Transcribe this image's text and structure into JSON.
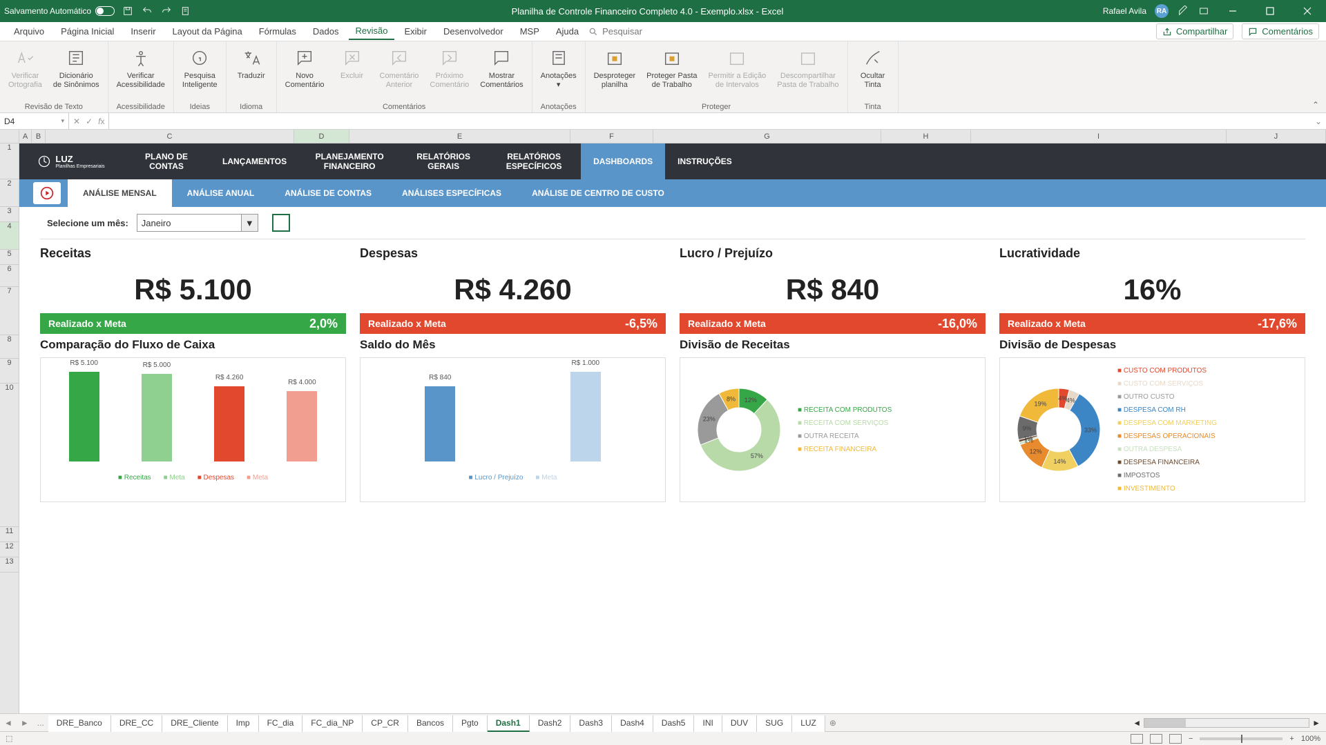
{
  "titlebar": {
    "autosave": "Salvamento Automático",
    "title": "Planilha de Controle Financeiro Completo 4.0 - Exemplo.xlsx  -  Excel",
    "user": "Rafael Avila",
    "initials": "RA"
  },
  "menu": {
    "items": [
      "Arquivo",
      "Página Inicial",
      "Inserir",
      "Layout da Página",
      "Fórmulas",
      "Dados",
      "Revisão",
      "Exibir",
      "Desenvolvedor",
      "MSP",
      "Ajuda"
    ],
    "active": "Revisão",
    "search": "Pesquisar",
    "share": "Compartilhar",
    "comments": "Comentários"
  },
  "ribbon": {
    "g1": {
      "label": "Revisão de Texto",
      "b1a": "Verificar",
      "b1b": "Ortografia",
      "b2a": "Dicionário",
      "b2b": "de Sinônimos"
    },
    "g2": {
      "label": "Acessibilidade",
      "b1a": "Verificar",
      "b1b": "Acessibilidade"
    },
    "g3": {
      "label": "Ideias",
      "b1a": "Pesquisa",
      "b1b": "Inteligente"
    },
    "g4": {
      "label": "Idioma",
      "b1": "Traduzir"
    },
    "g5": {
      "label": "Comentários",
      "b1a": "Novo",
      "b1b": "Comentário",
      "b2": "Excluir",
      "b3a": "Comentário",
      "b3b": "Anterior",
      "b4a": "Próximo",
      "b4b": "Comentário",
      "b5a": "Mostrar",
      "b5b": "Comentários"
    },
    "g6": {
      "label": "Anotações",
      "b1": "Anotações"
    },
    "g7": {
      "label": "Proteger",
      "b1a": "Desproteger",
      "b1b": "planilha",
      "b2a": "Proteger Pasta",
      "b2b": "de Trabalho",
      "b3a": "Permitir a Edição",
      "b3b": "de Intervalos",
      "b4a": "Descompartilhar",
      "b4b": "Pasta de Trabalho"
    },
    "g8": {
      "label": "Tinta",
      "b1a": "Ocultar",
      "b1b": "Tinta"
    }
  },
  "namebox": "D4",
  "columns": [
    "A",
    "B",
    "C",
    "D",
    "E",
    "F",
    "G",
    "H",
    "I",
    "J"
  ],
  "rows": [
    "1",
    "2",
    "3",
    "4",
    "5",
    "6",
    "7",
    "8",
    "9",
    "10",
    "11",
    "12",
    "13"
  ],
  "nav": {
    "logo": "LUZ",
    "logosub": "Planilhas Empresariais",
    "items": [
      "PLANO DE CONTAS",
      "LANÇAMENTOS",
      "PLANEJAMENTO FINANCEIRO",
      "RELATÓRIOS GERAIS",
      "RELATÓRIOS ESPECÍFICOS",
      "DASHBOARDS",
      "INSTRUÇÕES"
    ],
    "active": "DASHBOARDS"
  },
  "subnav": {
    "items": [
      "ANÁLISE MENSAL",
      "ANÁLISE ANUAL",
      "ANÁLISE DE CONTAS",
      "ANÁLISES ESPECÍFICAS",
      "ANÁLISE DE CENTRO DE CUSTO"
    ],
    "active": "ANÁLISE MENSAL"
  },
  "month": {
    "label": "Selecione um mês:",
    "value": "Janeiro"
  },
  "kpi": {
    "receitas": {
      "title": "Receitas",
      "value": "R$ 5.100",
      "sub": "Realizado x Meta",
      "pct": "2,0%",
      "color": "green"
    },
    "despesas": {
      "title": "Despesas",
      "value": "R$ 4.260",
      "sub": "Realizado x Meta",
      "pct": "-6,5%",
      "color": "red"
    },
    "lucro": {
      "title": "Lucro / Prejuízo",
      "value": "R$ 840",
      "sub": "Realizado x Meta",
      "pct": "-16,0%",
      "color": "red"
    },
    "lucratividade": {
      "title": "Lucratividade",
      "value": "16%",
      "sub": "Realizado x Meta",
      "pct": "-17,6%",
      "color": "red"
    }
  },
  "charts": {
    "fluxo": {
      "title": "Comparação do Fluxo de Caixa",
      "legend": [
        "Receitas",
        "Meta",
        "Despesas",
        "Meta"
      ]
    },
    "saldo": {
      "title": "Saldo do Mês",
      "legend": [
        "Lucro / Prejuízo",
        "Meta"
      ]
    },
    "divrec": {
      "title": "Divisão de Receitas",
      "legend": [
        "RECEITA COM PRODUTOS",
        "RECEITA COM SERVIÇOS",
        "OUTRA RECEITA",
        "RECEITA FINANCEIRA"
      ]
    },
    "divdesp": {
      "title": "Divisão de Despesas",
      "legend": [
        "CUSTO COM PRODUTOS",
        "CUSTO COM SERVIÇOS",
        "OUTRO CUSTO",
        "DESPESA COM RH",
        "DESPESA COM MARKETING",
        "DESPESAS OPERACIONAIS",
        "OUTRA DESPESA",
        "DESPESA FINANCEIRA",
        "IMPOSTOS",
        "INVESTIMENTO"
      ]
    }
  },
  "chart_data": [
    {
      "type": "bar",
      "title": "Comparação do Fluxo de Caixa",
      "categories": [
        "Receitas",
        "Meta",
        "Despesas",
        "Meta"
      ],
      "values": [
        5100,
        5000,
        4260,
        4000
      ],
      "labels": [
        "R$ 5.100",
        "R$ 5.000",
        "R$ 4.260",
        "R$ 4.000"
      ],
      "colors": [
        "#36a747",
        "#8fcf8f",
        "#e2482d",
        "#f19e90"
      ]
    },
    {
      "type": "bar",
      "title": "Saldo do Mês",
      "categories": [
        "Lucro / Prejuízo",
        "Meta"
      ],
      "values": [
        840,
        1000
      ],
      "labels": [
        "R$ 840",
        "R$ 1.000"
      ],
      "colors": [
        "#5a95c9",
        "#bdd5ea"
      ]
    },
    {
      "type": "pie",
      "title": "Divisão de Receitas",
      "series": [
        {
          "name": "RECEITA COM PRODUTOS",
          "value": 12,
          "color": "#36a747"
        },
        {
          "name": "RECEITA COM SERVIÇOS",
          "value": 57,
          "color": "#b8d9a8"
        },
        {
          "name": "OUTRA RECEITA",
          "value": 23,
          "color": "#9a9a9a"
        },
        {
          "name": "RECEITA FINANCEIRA",
          "value": 8,
          "color": "#f0b93a"
        }
      ]
    },
    {
      "type": "pie",
      "title": "Divisão de Despesas",
      "series": [
        {
          "name": "CUSTO COM PRODUTOS",
          "value": 4,
          "color": "#e2482d"
        },
        {
          "name": "CUSTO COM SERVIÇOS",
          "value": 4,
          "color": "#e8d8c8"
        },
        {
          "name": "OUTRO CUSTO",
          "value": 0,
          "color": "#9a9a9a"
        },
        {
          "name": "DESPESA COM RH",
          "value": 33,
          "color": "#3d86c6"
        },
        {
          "name": "DESPESA COM MARKETING",
          "value": 14,
          "color": "#f0d060"
        },
        {
          "name": "DESPESAS OPERACIONAIS",
          "value": 12,
          "color": "#e88b2e"
        },
        {
          "name": "OUTRA DESPESA",
          "value": 1,
          "color": "#c9e0c0"
        },
        {
          "name": "DESPESA FINANCEIRA",
          "value": 1,
          "color": "#6b4a30"
        },
        {
          "name": "IMPOSTOS",
          "value": 9,
          "color": "#6b6b6b"
        },
        {
          "name": "INVESTIMENTO",
          "value": 19,
          "color": "#f0b93a"
        }
      ]
    }
  ],
  "tabs": {
    "items": [
      "DRE_Banco",
      "DRE_CC",
      "DRE_Cliente",
      "Imp",
      "FC_dia",
      "FC_dia_NP",
      "CP_CR",
      "Bancos",
      "Pgto",
      "Dash1",
      "Dash2",
      "Dash3",
      "Dash4",
      "Dash5",
      "INI",
      "DUV",
      "SUG",
      "LUZ"
    ],
    "active": "Dash1",
    "more": "..."
  },
  "status": {
    "zoom": "100%"
  }
}
